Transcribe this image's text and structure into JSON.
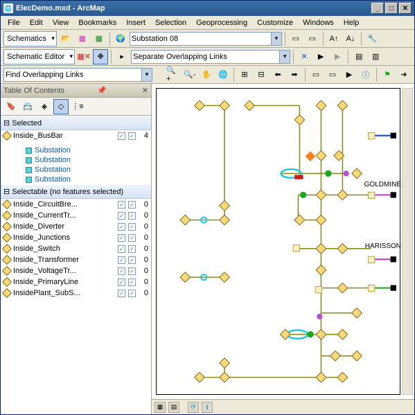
{
  "window": {
    "title": "ElecDemo.mxd - ArcMap"
  },
  "menubar": [
    "File",
    "Edit",
    "View",
    "Bookmarks",
    "Insert",
    "Selection",
    "Geoprocessing",
    "Customize",
    "Windows",
    "Help"
  ],
  "toolbar1": {
    "schematics_label": "Schematics",
    "combo_value": "Substation 08"
  },
  "toolbar2": {
    "editor_label": "Schematic Editor",
    "combo_value": "Separate Overlapping Links"
  },
  "toolbar3": {
    "search_value": "Find Overlapping Links"
  },
  "toc": {
    "title": "Table Of Contents",
    "selected_header": "Selected",
    "bus_layer": {
      "name": "Inside_BusBar",
      "count": "4"
    },
    "subs": [
      "Substation",
      "Substation",
      "Substation",
      "Substation"
    ],
    "selectable_header": "Selectable (no features selected)",
    "layers": [
      {
        "name": "Inside_CircuitBre...",
        "count": "0"
      },
      {
        "name": "Inside_CurrentTr...",
        "count": "0"
      },
      {
        "name": "Inside_Diverter",
        "count": "0"
      },
      {
        "name": "Inside_Junctions",
        "count": "0"
      },
      {
        "name": "Inside_Switch",
        "count": "0"
      },
      {
        "name": "Inside_Transformer",
        "count": "0"
      },
      {
        "name": "Inside_VoltageTr...",
        "count": "0"
      },
      {
        "name": "Inside_PrimaryLine",
        "count": "0"
      },
      {
        "name": "InsidePlant_SubS...",
        "count": "0"
      }
    ]
  },
  "map_labels": {
    "goldmine": "GOLDMINE",
    "harisson": "HARISSON"
  },
  "colors": {
    "olive": "#8a8a1a",
    "diamond_fill": "#f5d97a",
    "diamond_stroke": "#8a6d1a",
    "cyan": "#24c8e0",
    "green": "#1aa71a",
    "magenta": "#c537c5",
    "orange": "#ff7f1a",
    "red": "#d11a1a",
    "blue": "#1a4ad1"
  }
}
